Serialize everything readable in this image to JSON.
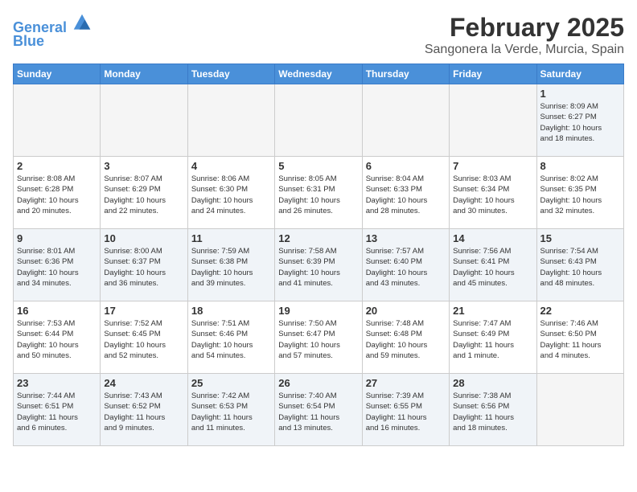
{
  "header": {
    "logo_line1": "General",
    "logo_line2": "Blue",
    "month": "February 2025",
    "location": "Sangonera la Verde, Murcia, Spain"
  },
  "days_of_week": [
    "Sunday",
    "Monday",
    "Tuesday",
    "Wednesday",
    "Thursday",
    "Friday",
    "Saturday"
  ],
  "weeks": [
    [
      {
        "day": "",
        "info": ""
      },
      {
        "day": "",
        "info": ""
      },
      {
        "day": "",
        "info": ""
      },
      {
        "day": "",
        "info": ""
      },
      {
        "day": "",
        "info": ""
      },
      {
        "day": "",
        "info": ""
      },
      {
        "day": "1",
        "info": "Sunrise: 8:09 AM\nSunset: 6:27 PM\nDaylight: 10 hours\nand 18 minutes."
      }
    ],
    [
      {
        "day": "2",
        "info": "Sunrise: 8:08 AM\nSunset: 6:28 PM\nDaylight: 10 hours\nand 20 minutes."
      },
      {
        "day": "3",
        "info": "Sunrise: 8:07 AM\nSunset: 6:29 PM\nDaylight: 10 hours\nand 22 minutes."
      },
      {
        "day": "4",
        "info": "Sunrise: 8:06 AM\nSunset: 6:30 PM\nDaylight: 10 hours\nand 24 minutes."
      },
      {
        "day": "5",
        "info": "Sunrise: 8:05 AM\nSunset: 6:31 PM\nDaylight: 10 hours\nand 26 minutes."
      },
      {
        "day": "6",
        "info": "Sunrise: 8:04 AM\nSunset: 6:33 PM\nDaylight: 10 hours\nand 28 minutes."
      },
      {
        "day": "7",
        "info": "Sunrise: 8:03 AM\nSunset: 6:34 PM\nDaylight: 10 hours\nand 30 minutes."
      },
      {
        "day": "8",
        "info": "Sunrise: 8:02 AM\nSunset: 6:35 PM\nDaylight: 10 hours\nand 32 minutes."
      }
    ],
    [
      {
        "day": "9",
        "info": "Sunrise: 8:01 AM\nSunset: 6:36 PM\nDaylight: 10 hours\nand 34 minutes."
      },
      {
        "day": "10",
        "info": "Sunrise: 8:00 AM\nSunset: 6:37 PM\nDaylight: 10 hours\nand 36 minutes."
      },
      {
        "day": "11",
        "info": "Sunrise: 7:59 AM\nSunset: 6:38 PM\nDaylight: 10 hours\nand 39 minutes."
      },
      {
        "day": "12",
        "info": "Sunrise: 7:58 AM\nSunset: 6:39 PM\nDaylight: 10 hours\nand 41 minutes."
      },
      {
        "day": "13",
        "info": "Sunrise: 7:57 AM\nSunset: 6:40 PM\nDaylight: 10 hours\nand 43 minutes."
      },
      {
        "day": "14",
        "info": "Sunrise: 7:56 AM\nSunset: 6:41 PM\nDaylight: 10 hours\nand 45 minutes."
      },
      {
        "day": "15",
        "info": "Sunrise: 7:54 AM\nSunset: 6:43 PM\nDaylight: 10 hours\nand 48 minutes."
      }
    ],
    [
      {
        "day": "16",
        "info": "Sunrise: 7:53 AM\nSunset: 6:44 PM\nDaylight: 10 hours\nand 50 minutes."
      },
      {
        "day": "17",
        "info": "Sunrise: 7:52 AM\nSunset: 6:45 PM\nDaylight: 10 hours\nand 52 minutes."
      },
      {
        "day": "18",
        "info": "Sunrise: 7:51 AM\nSunset: 6:46 PM\nDaylight: 10 hours\nand 54 minutes."
      },
      {
        "day": "19",
        "info": "Sunrise: 7:50 AM\nSunset: 6:47 PM\nDaylight: 10 hours\nand 57 minutes."
      },
      {
        "day": "20",
        "info": "Sunrise: 7:48 AM\nSunset: 6:48 PM\nDaylight: 10 hours\nand 59 minutes."
      },
      {
        "day": "21",
        "info": "Sunrise: 7:47 AM\nSunset: 6:49 PM\nDaylight: 11 hours\nand 1 minute."
      },
      {
        "day": "22",
        "info": "Sunrise: 7:46 AM\nSunset: 6:50 PM\nDaylight: 11 hours\nand 4 minutes."
      }
    ],
    [
      {
        "day": "23",
        "info": "Sunrise: 7:44 AM\nSunset: 6:51 PM\nDaylight: 11 hours\nand 6 minutes."
      },
      {
        "day": "24",
        "info": "Sunrise: 7:43 AM\nSunset: 6:52 PM\nDaylight: 11 hours\nand 9 minutes."
      },
      {
        "day": "25",
        "info": "Sunrise: 7:42 AM\nSunset: 6:53 PM\nDaylight: 11 hours\nand 11 minutes."
      },
      {
        "day": "26",
        "info": "Sunrise: 7:40 AM\nSunset: 6:54 PM\nDaylight: 11 hours\nand 13 minutes."
      },
      {
        "day": "27",
        "info": "Sunrise: 7:39 AM\nSunset: 6:55 PM\nDaylight: 11 hours\nand 16 minutes."
      },
      {
        "day": "28",
        "info": "Sunrise: 7:38 AM\nSunset: 6:56 PM\nDaylight: 11 hours\nand 18 minutes."
      },
      {
        "day": "",
        "info": ""
      }
    ]
  ]
}
